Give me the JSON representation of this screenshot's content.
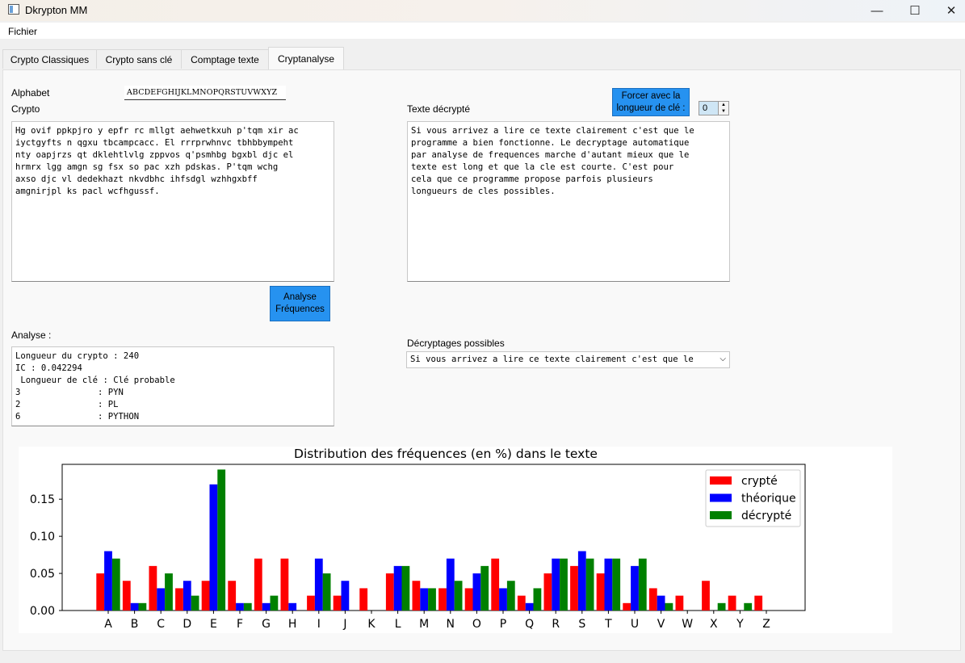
{
  "window": {
    "title": "Dkrypton MM",
    "controls": {
      "minimize": "—",
      "maximize": "☐",
      "close": "✕"
    }
  },
  "menu": {
    "items": [
      "Fichier"
    ]
  },
  "tabs": [
    {
      "label": "Crypto Classiques",
      "active": false
    },
    {
      "label": "Crypto sans clé",
      "active": false
    },
    {
      "label": "Comptage texte",
      "active": false
    },
    {
      "label": "Cryptanalyse",
      "active": true
    }
  ],
  "form": {
    "alphabet_label": "Alphabet",
    "alphabet_value": "ABCDEFGHIJKLMNOPQRSTUVWXYZ",
    "crypto_label": "Crypto",
    "crypto_text": "Hg ovif ppkpjro y epfr rc mllgt aehwetkxuh p'tqm xir ac\niyctgyfts n qgxu tbcampcacc. El rrrprwhnvc tbhbbympeht\nnty oapjrzs qt dklehtlvlg zppvos q'psmhbg bgxbl djc el\nhrmrx lgg amgn sg fsx so pac xzh pdskas. P'tqm wchg\naxso djc vl dedekhazt nkvdbhc ihfsdgl wzhhgxbff\namgnirjpl ks pacl wcfhgussf.",
    "decrypted_label": "Texte décrypté",
    "decrypted_text": "Si vous arrivez a lire ce texte clairement c'est que le\nprogramme a bien fonctionne. Le decryptage automatique\npar analyse de frequences marche d'autant mieux que le\ntexte est long et que la cle est courte. C'est pour\ncela que ce programme propose parfois plusieurs\nlongueurs de cles possibles.",
    "force_button": "Forcer avec la longueur de clé :",
    "force_value": "0",
    "analyse_button": "Analyse Fréquences",
    "analyse_label": "Analyse :",
    "analyse_text": "Longueur du crypto : 240\nIC : 0.042294\n Longueur de clé : Clé probable\n3               : PYN\n2               : PL\n6               : PYTHON",
    "possible_label": "Décryptages possibles",
    "possible_value": "Si vous arrivez a lire ce texte clairement c'est que le"
  },
  "chart_data": {
    "type": "bar",
    "title": "Distribution des fréquences (en %) dans le texte",
    "xlabel": "",
    "ylabel": "",
    "ylim": [
      0,
      0.197
    ],
    "yticks": [
      "0.00",
      "0.05",
      "0.10",
      "0.15"
    ],
    "ytick_values": [
      0,
      0.05,
      0.1,
      0.15
    ],
    "legend_position": "top-right",
    "categories": [
      "A",
      "B",
      "C",
      "D",
      "E",
      "F",
      "G",
      "H",
      "I",
      "J",
      "K",
      "L",
      "M",
      "N",
      "O",
      "P",
      "Q",
      "R",
      "S",
      "T",
      "U",
      "V",
      "W",
      "X",
      "Y",
      "Z"
    ],
    "series": [
      {
        "name": "crypté",
        "color": "#ff0000",
        "values": [
          0.05,
          0.04,
          0.06,
          0.03,
          0.04,
          0.04,
          0.07,
          0.07,
          0.02,
          0.02,
          0.03,
          0.05,
          0.04,
          0.03,
          0.03,
          0.07,
          0.02,
          0.05,
          0.06,
          0.05,
          0.01,
          0.03,
          0.02,
          0.04,
          0.02,
          0.02
        ]
      },
      {
        "name": "théorique",
        "color": "#0000ff",
        "values": [
          0.08,
          0.01,
          0.03,
          0.04,
          0.17,
          0.01,
          0.01,
          0.01,
          0.07,
          0.04,
          0.0,
          0.06,
          0.03,
          0.07,
          0.05,
          0.03,
          0.01,
          0.07,
          0.08,
          0.07,
          0.06,
          0.02,
          0.0,
          0.0,
          0.0,
          0.0
        ]
      },
      {
        "name": "décrypté",
        "color": "#008000",
        "values": [
          0.07,
          0.01,
          0.05,
          0.02,
          0.19,
          0.01,
          0.02,
          0.0,
          0.05,
          0.0,
          0.0,
          0.06,
          0.03,
          0.04,
          0.06,
          0.04,
          0.03,
          0.07,
          0.07,
          0.07,
          0.07,
          0.01,
          0.0,
          0.01,
          0.01,
          0.0
        ]
      }
    ]
  }
}
